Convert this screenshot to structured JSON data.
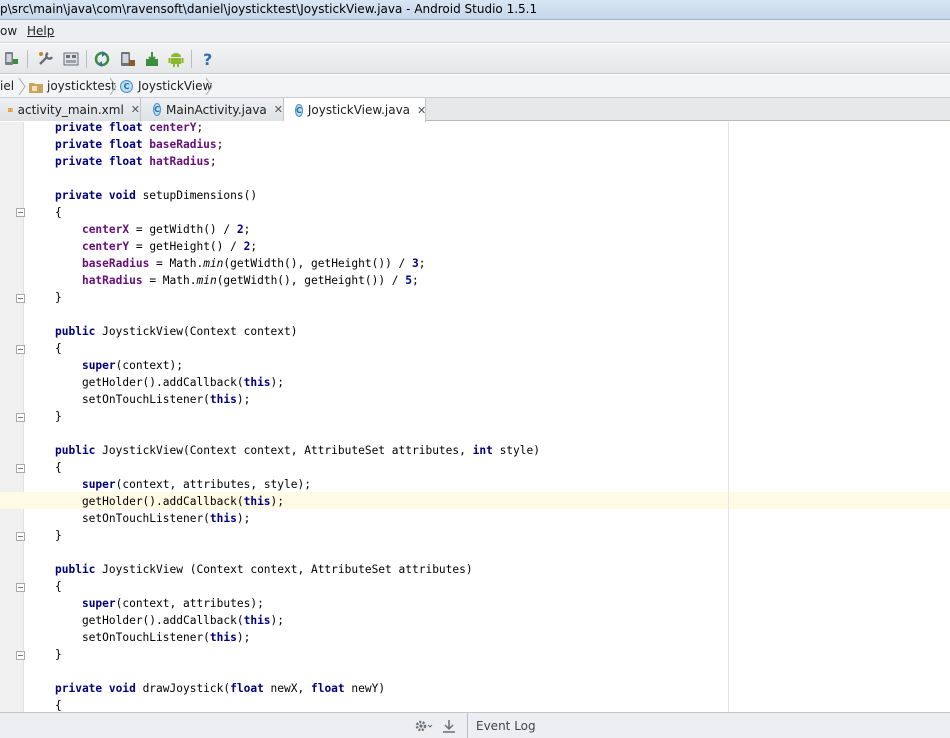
{
  "window": {
    "title": "p\\src\\main\\java\\com\\ravensoft\\daniel\\joysticktest\\JoystickView.java - Android Studio 1.5.1"
  },
  "menu": {
    "items": [
      {
        "label": "ow"
      },
      {
        "label": "Help"
      }
    ]
  },
  "toolbar": {
    "icons": [
      "device-icon",
      "wrench-icon",
      "structure-icon",
      "sync-icon",
      "avd-icon",
      "sdk-icon",
      "android-icon",
      "help-icon"
    ]
  },
  "breadcrumbs": [
    {
      "label": "iel"
    },
    {
      "label": "joysticktest"
    },
    {
      "label": "JoystickView"
    }
  ],
  "tabs": [
    {
      "label": "activity_main.xml",
      "close": "✕"
    },
    {
      "label": "MainActivity.java",
      "close": "✕"
    },
    {
      "label": "JoystickView.java",
      "close": "✕"
    }
  ],
  "colors": {
    "keyword": "#000080",
    "field": "#660e7a",
    "caret_row": "#fffae3"
  },
  "status": {
    "event_log": "Event Log"
  }
}
